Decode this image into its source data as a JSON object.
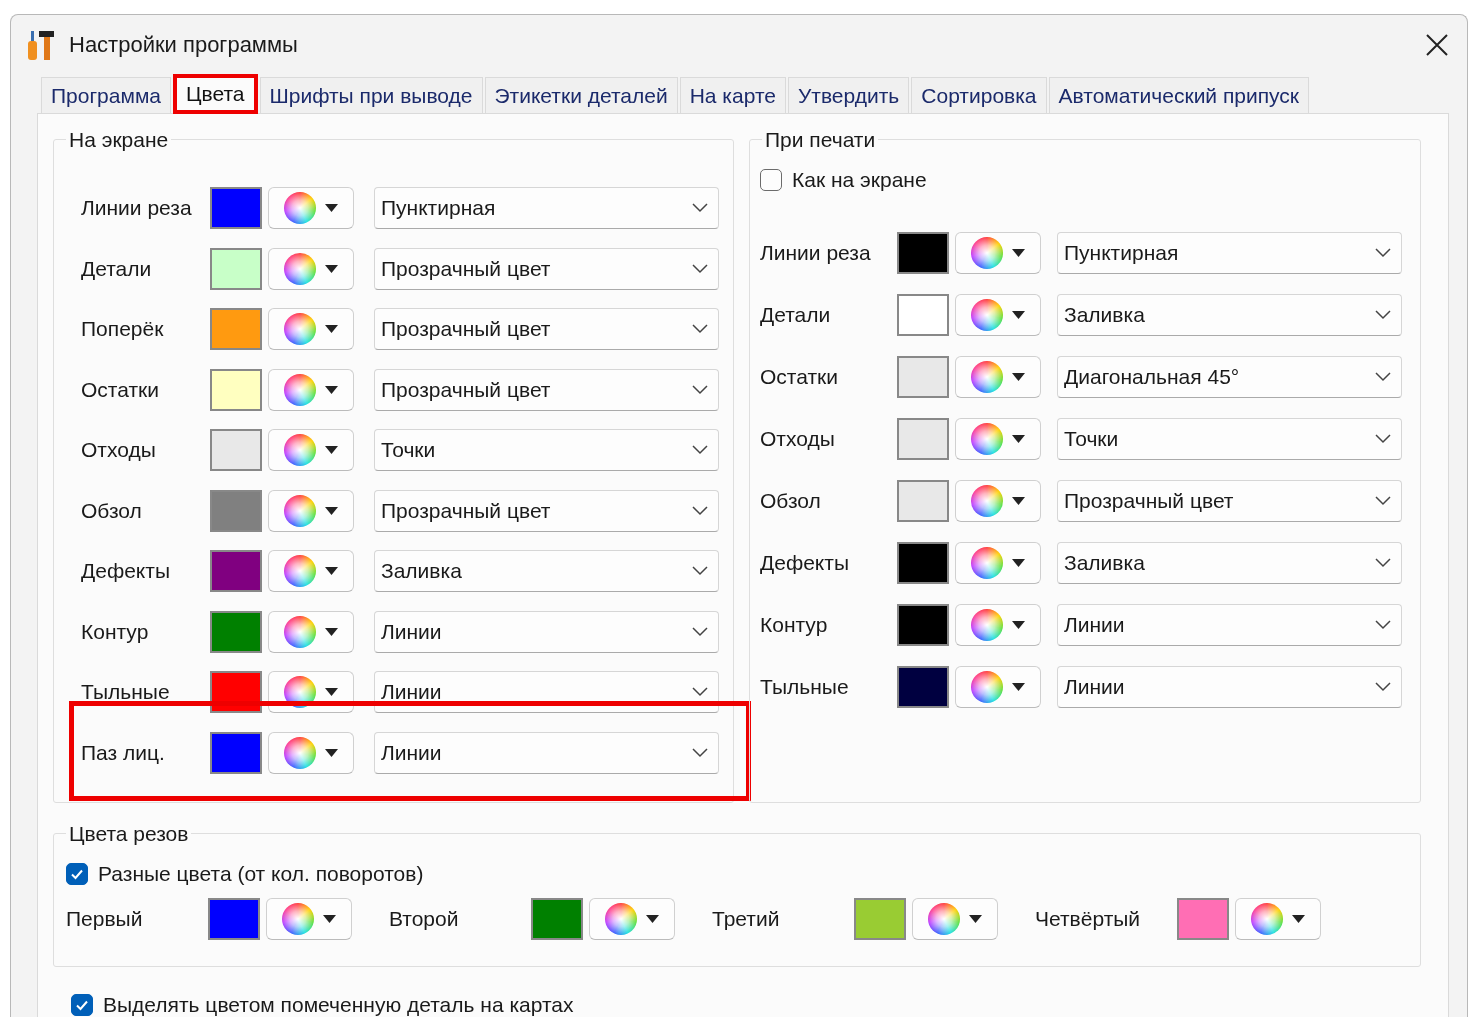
{
  "window": {
    "title": "Настройки программы"
  },
  "tabs": [
    {
      "label": "Программа",
      "selected": false,
      "highlighted": false
    },
    {
      "label": "Цвета",
      "selected": true,
      "highlighted": true
    },
    {
      "label": "Шрифты при выводе",
      "selected": false,
      "highlighted": false
    },
    {
      "label": "Этикетки деталей",
      "selected": false,
      "highlighted": false
    },
    {
      "label": "На карте",
      "selected": false,
      "highlighted": false
    },
    {
      "label": "Утвердить",
      "selected": false,
      "highlighted": false
    },
    {
      "label": "Сортировка",
      "selected": false,
      "highlighted": false
    },
    {
      "label": "Автоматический припуск",
      "selected": false,
      "highlighted": false
    }
  ],
  "screen_group": {
    "title": "На экране",
    "rows": [
      {
        "label": "Линии реза",
        "color": "#0000ff",
        "style": "Пунктирная",
        "highlighted": false
      },
      {
        "label": "Детали",
        "color": "#c8ffc8",
        "style": "Прозрачный цвет",
        "highlighted": false
      },
      {
        "label": "Поперёк",
        "color": "#ff9a10",
        "style": "Прозрачный цвет",
        "highlighted": false
      },
      {
        "label": "Остатки",
        "color": "#ffffc0",
        "style": "Прозрачный цвет",
        "highlighted": false
      },
      {
        "label": "Отходы",
        "color": "#e8e8e8",
        "style": "Точки",
        "highlighted": false
      },
      {
        "label": "Обзол",
        "color": "#808080",
        "style": "Прозрачный цвет",
        "highlighted": false
      },
      {
        "label": "Дефекты",
        "color": "#800080",
        "style": "Заливка",
        "highlighted": false
      },
      {
        "label": "Контур",
        "color": "#008000",
        "style": "Линии",
        "highlighted": false
      },
      {
        "label": "Тыльные",
        "color": "#ff0000",
        "style": "Линии",
        "highlighted": false
      },
      {
        "label": "Паз лиц.",
        "color": "#0000ff",
        "style": "Линии",
        "highlighted": true
      }
    ]
  },
  "print_group": {
    "title": "При печати",
    "same_as_screen": {
      "label": "Как на экране",
      "checked": false
    },
    "rows": [
      {
        "label": "Линии реза",
        "color": "#000000",
        "style": "Пунктирная"
      },
      {
        "label": "Детали",
        "color": "#ffffff",
        "style": "Заливка"
      },
      {
        "label": "Остатки",
        "color": "#e8e8e8",
        "style": "Диагональная 45°"
      },
      {
        "label": "Отходы",
        "color": "#e8e8e8",
        "style": "Точки"
      },
      {
        "label": "Обзол",
        "color": "#e8e8e8",
        "style": "Прозрачный цвет"
      },
      {
        "label": "Дефекты",
        "color": "#000000",
        "style": "Заливка"
      },
      {
        "label": "Контур",
        "color": "#000000",
        "style": "Линии"
      },
      {
        "label": "Тыльные",
        "color": "#000040",
        "style": "Линии"
      }
    ]
  },
  "cut_colors": {
    "title": "Цвета резов",
    "different_colors": {
      "label": "Разные цвета (от кол. поворотов)",
      "checked": true
    },
    "items": [
      {
        "label": "Первый",
        "color": "#0000ff"
      },
      {
        "label": "Второй",
        "color": "#008000"
      },
      {
        "label": "Третий",
        "color": "#99cc33"
      },
      {
        "label": "Четвёртый",
        "color": "#ff6eb4"
      }
    ]
  },
  "highlight_marked": {
    "label": "Выделять цветом помеченную деталь на картах",
    "checked": true
  }
}
